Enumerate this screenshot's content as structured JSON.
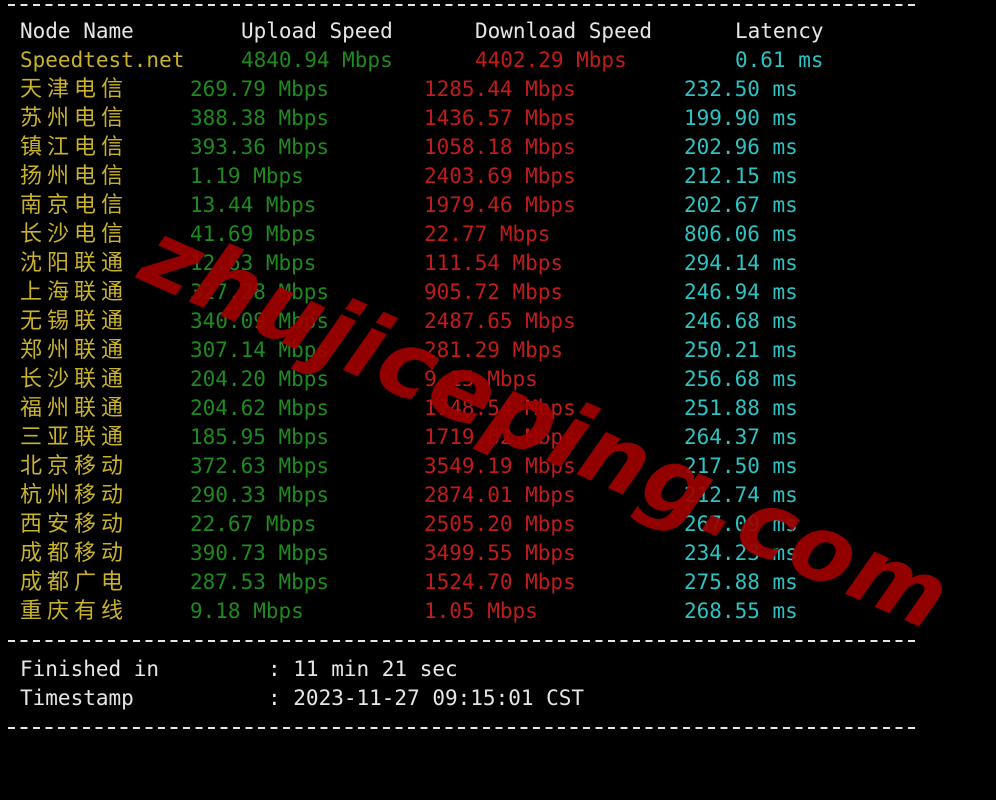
{
  "header": {
    "node_name": "Node Name",
    "upload_speed": "Upload Speed",
    "download_speed": "Download Speed",
    "latency": "Latency"
  },
  "speedtest": {
    "name": "Speedtest.net",
    "upload": "4840.94 Mbps",
    "download": "4402.29 Mbps",
    "latency": "0.61 ms"
  },
  "rows": [
    {
      "name": "天津电信",
      "upload": "269.79 Mbps",
      "download": "1285.44 Mbps",
      "latency": "232.50 ms"
    },
    {
      "name": "苏州电信",
      "upload": "388.38 Mbps",
      "download": "1436.57 Mbps",
      "latency": "199.90 ms"
    },
    {
      "name": "镇江电信",
      "upload": "393.36 Mbps",
      "download": "1058.18 Mbps",
      "latency": "202.96 ms"
    },
    {
      "name": "扬州电信",
      "upload": "1.19 Mbps",
      "download": "2403.69 Mbps",
      "latency": "212.15 ms"
    },
    {
      "name": "南京电信",
      "upload": "13.44 Mbps",
      "download": "1979.46 Mbps",
      "latency": "202.67 ms"
    },
    {
      "name": "长沙电信",
      "upload": "41.69 Mbps",
      "download": "22.77 Mbps",
      "latency": "806.06 ms"
    },
    {
      "name": "沈阳联通",
      "upload": "12.63 Mbps",
      "download": "111.54 Mbps",
      "latency": "294.14 ms"
    },
    {
      "name": "上海联通",
      "upload": "327.28 Mbps",
      "download": "905.72 Mbps",
      "latency": "246.94 ms"
    },
    {
      "name": "无锡联通",
      "upload": "340.09 Mbps",
      "download": "2487.65 Mbps",
      "latency": "246.68 ms"
    },
    {
      "name": "郑州联通",
      "upload": "307.14 Mbps",
      "download": "281.29 Mbps",
      "latency": "250.21 ms"
    },
    {
      "name": "长沙联通",
      "upload": "204.20 Mbps",
      "download": "9.15 Mbps",
      "latency": "256.68 ms"
    },
    {
      "name": "福州联通",
      "upload": "204.62 Mbps",
      "download": "1748.54 Mbps",
      "latency": "251.88 ms"
    },
    {
      "name": "三亚联通",
      "upload": "185.95 Mbps",
      "download": "1719.62 Mbps",
      "latency": "264.37 ms"
    },
    {
      "name": "北京移动",
      "upload": "372.63 Mbps",
      "download": "3549.19 Mbps",
      "latency": "217.50 ms"
    },
    {
      "name": "杭州移动",
      "upload": "290.33 Mbps",
      "download": "2874.01 Mbps",
      "latency": "212.74 ms"
    },
    {
      "name": "西安移动",
      "upload": "22.67 Mbps",
      "download": "2505.20 Mbps",
      "latency": "267.09 ms"
    },
    {
      "name": "成都移动",
      "upload": "390.73 Mbps",
      "download": "3499.55 Mbps",
      "latency": "234.23 ms"
    },
    {
      "name": "成都广电",
      "upload": "287.53 Mbps",
      "download": "1524.70 Mbps",
      "latency": "275.88 ms"
    },
    {
      "name": "重庆有线",
      "upload": "9.18 Mbps",
      "download": "1.05 Mbps",
      "latency": "268.55 ms"
    }
  ],
  "footer": {
    "finished_label": "Finished in",
    "finished_value": ": 11 min 21 sec",
    "timestamp_label": "Timestamp",
    "timestamp_value": ": 2023-11-27 09:15:01 CST"
  },
  "watermark": "zhujiceping.com",
  "colors": {
    "background": "#000000",
    "header_text": "#e6e6e6",
    "node_name": "#c8b22e",
    "upload": "#1f8a1f",
    "download": "#c01c1c",
    "latency": "#2fc2c2",
    "watermark": "#a00000"
  }
}
